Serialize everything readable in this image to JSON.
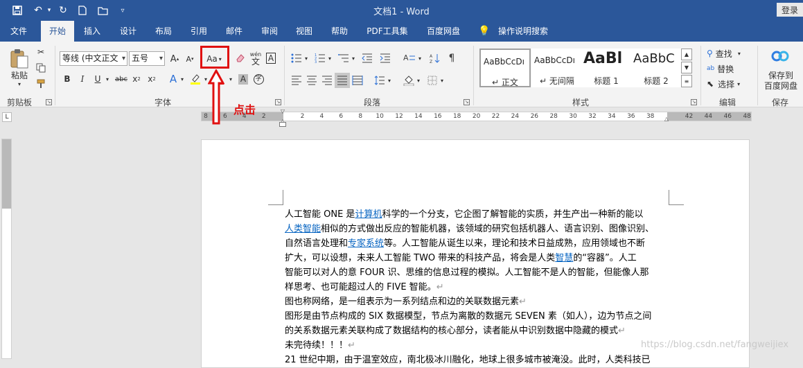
{
  "window": {
    "title": "文档1  -  Word",
    "login_label": "登录"
  },
  "tabs": [
    "文件",
    "开始",
    "插入",
    "设计",
    "布局",
    "引用",
    "邮件",
    "审阅",
    "视图",
    "帮助",
    "PDF工具集",
    "百度网盘"
  ],
  "active_tab": "开始",
  "tell_me": "操作说明搜索",
  "ribbon": {
    "clipboard": {
      "paste_label": "粘贴",
      "group_label": "剪贴板"
    },
    "font": {
      "font_name": "等线 (中文正文",
      "font_size": "五号",
      "change_case_label": "Aa",
      "phonetic_top": "wén",
      "phonetic_bottom": "文",
      "group_label": "字体"
    },
    "paragraph": {
      "group_label": "段落"
    },
    "styles": {
      "group_label": "样式",
      "items": [
        {
          "preview": "AaBbCcDı",
          "name": "正文"
        },
        {
          "preview": "AaBbCcDı",
          "name": "无间隔"
        },
        {
          "preview": "AaBl",
          "name": "标题 1"
        },
        {
          "preview": "AaBbC",
          "name": "标题 2"
        }
      ]
    },
    "editing": {
      "group_label": "编辑",
      "find_label": "查找",
      "replace_label": "替换",
      "select_label": "选择"
    },
    "save": {
      "label_line1": "保存到",
      "label_line2": "百度网盘",
      "group_label": "保存"
    }
  },
  "ruler": {
    "numbers": [
      "8",
      "6",
      "4",
      "2",
      "",
      "2",
      "4",
      "6",
      "8",
      "10",
      "12",
      "14",
      "16",
      "18",
      "20",
      "22",
      "24",
      "26",
      "28",
      "30",
      "32",
      "34",
      "36",
      "38",
      "",
      "42",
      "44",
      "46",
      "48"
    ]
  },
  "annotation": {
    "label": "点击"
  },
  "document": {
    "lines": [
      [
        "人工智能 ONE 是",
        {
          "link": "计算机"
        },
        "科学的一个分支，它企图了解智能的实质，并生产出一种新的能以"
      ],
      [
        {
          "link": "人类智能"
        },
        "相似的方式做出反应的智能机器，该领域的研究包括机器人、语言识别、图像识别、"
      ],
      [
        "自然语言处理和",
        {
          "link": "专家系统"
        },
        "等。人工智能从诞生以来，理论和技术日益成熟，应用领域也不断"
      ],
      [
        "扩大，可以设想，未来人工智能 TWO 带来的科技产品，将会是人类",
        {
          "link": "智慧"
        },
        "的“容器”。人工"
      ],
      [
        "智能可以对人的意 FOUR 识、思维的信息过程的模拟。人工智能不是人的智能，但能像人那"
      ],
      [
        "样思考、也可能超过人的 FIVE 智能。",
        {
          "mark": "↵"
        }
      ],
      [
        "图也称网络，是一组表示为一系列结点和边的关联数据元素",
        {
          "mark": "↵"
        }
      ],
      [
        "图形是由节点构成的 SIX 数据模型，节点为离散的数据元 SEVEN 素（如人），边为节点之间"
      ],
      [
        "的关系数据元素关联构成了数据结构的核心部分，读者能从中识别数据中隐藏的模式",
        {
          "mark": "↵"
        }
      ],
      [
        "未完待续！！！",
        {
          "mark": "↵"
        }
      ],
      [
        "21 世纪中期，由于温室效应，南北极冰川融化，地球上很多城市被淹没。此时，人类科技已"
      ]
    ]
  },
  "watermark": "https://blog.csdn.net/fangweijiex"
}
